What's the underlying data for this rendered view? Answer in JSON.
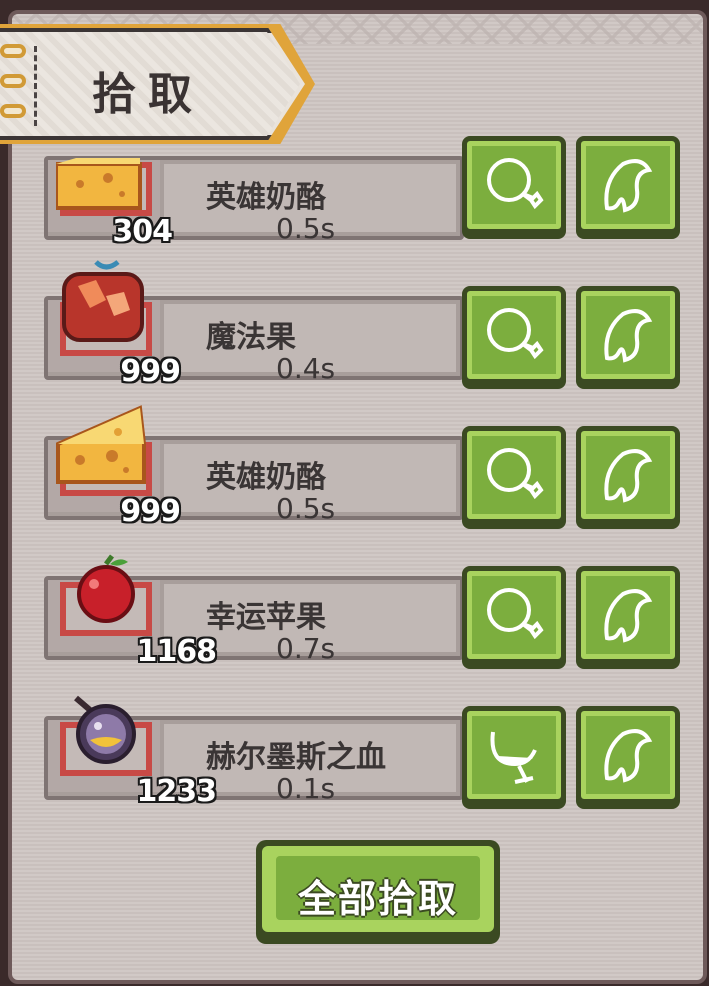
{
  "panel": {
    "title": "拾取"
  },
  "items": [
    {
      "name": "英雄奶酪",
      "time": "0.5s",
      "count": "304",
      "icon": "cheese-icon",
      "action_icon": "meat-icon"
    },
    {
      "name": "魔法果",
      "time": "0.4s",
      "count": "999",
      "icon": "magic-fruit-icon",
      "action_icon": "meat-icon"
    },
    {
      "name": "英雄奶酪",
      "time": "0.5s",
      "count": "999",
      "icon": "cheese-icon",
      "action_icon": "meat-icon"
    },
    {
      "name": "幸运苹果",
      "time": "0.7s",
      "count": "1168",
      "icon": "apple-icon",
      "action_icon": "meat-icon"
    },
    {
      "name": "赫尔墨斯之血",
      "time": "0.1s",
      "count": "1233",
      "icon": "potion-icon",
      "action_icon": "glass-icon"
    }
  ],
  "footer": {
    "pick_all_label": "全部拾取"
  },
  "colors": {
    "button_green": "#7cae3e",
    "button_light": "#a9d35e",
    "button_dark": "#3b4a22",
    "frame_red": "#c84a46",
    "tab_gold": "#e0a43a"
  }
}
